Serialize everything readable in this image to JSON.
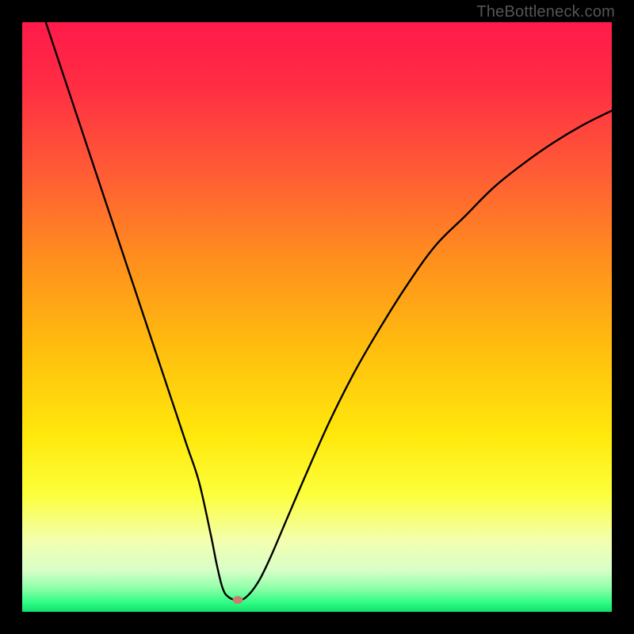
{
  "watermark": "TheBottleneck.com",
  "chart_data": {
    "type": "line",
    "title": "",
    "xlabel": "",
    "ylabel": "",
    "xlim": [
      0,
      100
    ],
    "ylim": [
      0,
      100
    ],
    "grid": false,
    "legend": false,
    "series": [
      {
        "name": "bottleneck-curve",
        "x": [
          4,
          6,
          8,
          10,
          12,
          14,
          16,
          18,
          20,
          22,
          24,
          26,
          28,
          30,
          32,
          33,
          34,
          35,
          36.5,
          38,
          40,
          42,
          45,
          48,
          52,
          56,
          60,
          65,
          70,
          75,
          80,
          85,
          90,
          95,
          100
        ],
        "y": [
          100,
          94,
          88,
          82,
          76,
          70,
          64,
          58,
          52,
          46,
          40,
          34,
          28,
          22,
          13,
          8,
          4,
          2.5,
          2,
          2.5,
          5,
          9,
          16,
          23,
          32,
          40,
          47,
          55,
          62,
          67,
          72,
          76,
          79.5,
          82.5,
          85
        ]
      }
    ],
    "marker": {
      "x": 36.5,
      "y": 2
    },
    "background_gradient": {
      "type": "vertical",
      "stops": [
        {
          "pos": 0.0,
          "color": "#ff1a4a"
        },
        {
          "pos": 0.1,
          "color": "#ff2b44"
        },
        {
          "pos": 0.25,
          "color": "#ff5a36"
        },
        {
          "pos": 0.4,
          "color": "#ff8e1e"
        },
        {
          "pos": 0.55,
          "color": "#ffbd0e"
        },
        {
          "pos": 0.7,
          "color": "#ffe80c"
        },
        {
          "pos": 0.8,
          "color": "#fcff3a"
        },
        {
          "pos": 0.88,
          "color": "#f3ffb0"
        },
        {
          "pos": 0.93,
          "color": "#d7ffc8"
        },
        {
          "pos": 0.96,
          "color": "#8effa8"
        },
        {
          "pos": 0.985,
          "color": "#2dfc83"
        },
        {
          "pos": 1.0,
          "color": "#12e06d"
        }
      ]
    },
    "curve_color": "#000000",
    "marker_color": "#c97f6f"
  }
}
